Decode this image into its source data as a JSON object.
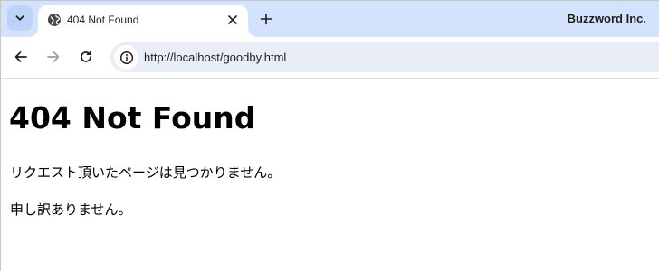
{
  "browser": {
    "tab": {
      "title": "404 Not Found",
      "favicon": "globe-icon"
    },
    "new_tab_label": "+",
    "profile_name": "Buzzword Inc.",
    "url": "http://localhost/goodby.html",
    "colors": {
      "tab_strip": "#d3e3fd",
      "omnibox": "#e9eef6",
      "icon": "#474747"
    }
  },
  "page": {
    "heading": "404 Not Found",
    "message1": "リクエスト頂いたページは見つかりません。",
    "message2": "申し訳ありません。"
  }
}
